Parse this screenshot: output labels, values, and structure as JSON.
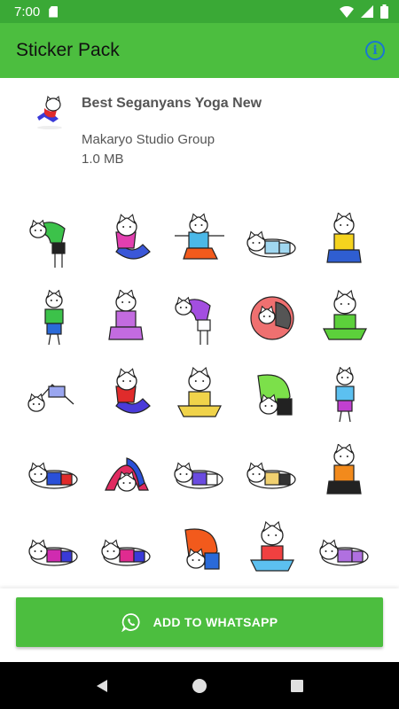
{
  "status": {
    "time": "7:00"
  },
  "app": {
    "title": "Sticker Pack"
  },
  "pack": {
    "name": "Best Seganyans Yoga New",
    "publisher": "Makaryo Studio Group",
    "size": "1.0 MB"
  },
  "stickers": [
    {
      "shirt": "#3cc24a",
      "pants": "#222222",
      "pose": "bend"
    },
    {
      "shirt": "#e23fb0",
      "pants": "#3a57d8",
      "pose": "twist"
    },
    {
      "shirt": "#4bb8e8",
      "pants": "#f25a1c",
      "pose": "arms"
    },
    {
      "shirt": "#a0d7f0",
      "pants": "#a0d7f0",
      "pose": "lie"
    },
    {
      "shirt": "#f5d31e",
      "pants": "#2f5ed1",
      "pose": "sit"
    },
    {
      "shirt": "#3cc24a",
      "pants": "#2a6ad8",
      "pose": "stand"
    },
    {
      "shirt": "#c36be0",
      "pants": "#c36be0",
      "pose": "sit"
    },
    {
      "shirt": "#a34ee0",
      "pants": "#ffffff",
      "pose": "bend"
    },
    {
      "shirt": "#ef7070",
      "pants": "#555555",
      "pose": "ball"
    },
    {
      "shirt": "#5cd03b",
      "pants": "#5cd03b",
      "pose": "meditate"
    },
    {
      "shirt": "#9aa6f0",
      "pants": "#ffffff",
      "pose": "dog"
    },
    {
      "shirt": "#e02b2b",
      "pants": "#4a3bd9",
      "pose": "twist"
    },
    {
      "shirt": "#f0d34a",
      "pants": "#f0d34a",
      "pose": "meditate"
    },
    {
      "shirt": "#7ce04a",
      "pants": "#222222",
      "pose": "fold"
    },
    {
      "shirt": "#5cc0f0",
      "pants": "#c140d0",
      "pose": "stand"
    },
    {
      "shirt": "#2a50d8",
      "pants": "#e02b2b",
      "pose": "lie"
    },
    {
      "shirt": "#e02b60",
      "pants": "#2a50d8",
      "pose": "bridge"
    },
    {
      "shirt": "#6a4be0",
      "pants": "#ffffff",
      "pose": "lie"
    },
    {
      "shirt": "#f0d070",
      "pants": "#333333",
      "pose": "lie"
    },
    {
      "shirt": "#f28a1c",
      "pants": "#222222",
      "pose": "sit"
    },
    {
      "shirt": "#d02bb0",
      "pants": "#3a3ad8",
      "pose": "lie"
    },
    {
      "shirt": "#e02b90",
      "pants": "#3a3ad8",
      "pose": "lie"
    },
    {
      "shirt": "#f25a1c",
      "pants": "#2a6ad8",
      "pose": "fold"
    },
    {
      "shirt": "#f04040",
      "pants": "#5cc0f0",
      "pose": "meditate"
    },
    {
      "shirt": "#b070e0",
      "pants": "#b070e0",
      "pose": "lie"
    }
  ],
  "actions": {
    "add_label": "ADD TO WHATSAPP"
  },
  "colors": {
    "primary": "#4cbe3f",
    "primary_dark": "#3aa936",
    "info": "#1976d2"
  },
  "icons": {
    "info": "info-icon",
    "whatsapp": "whatsapp-icon",
    "back": "back-icon",
    "home": "home-icon",
    "recents": "recents-icon"
  }
}
